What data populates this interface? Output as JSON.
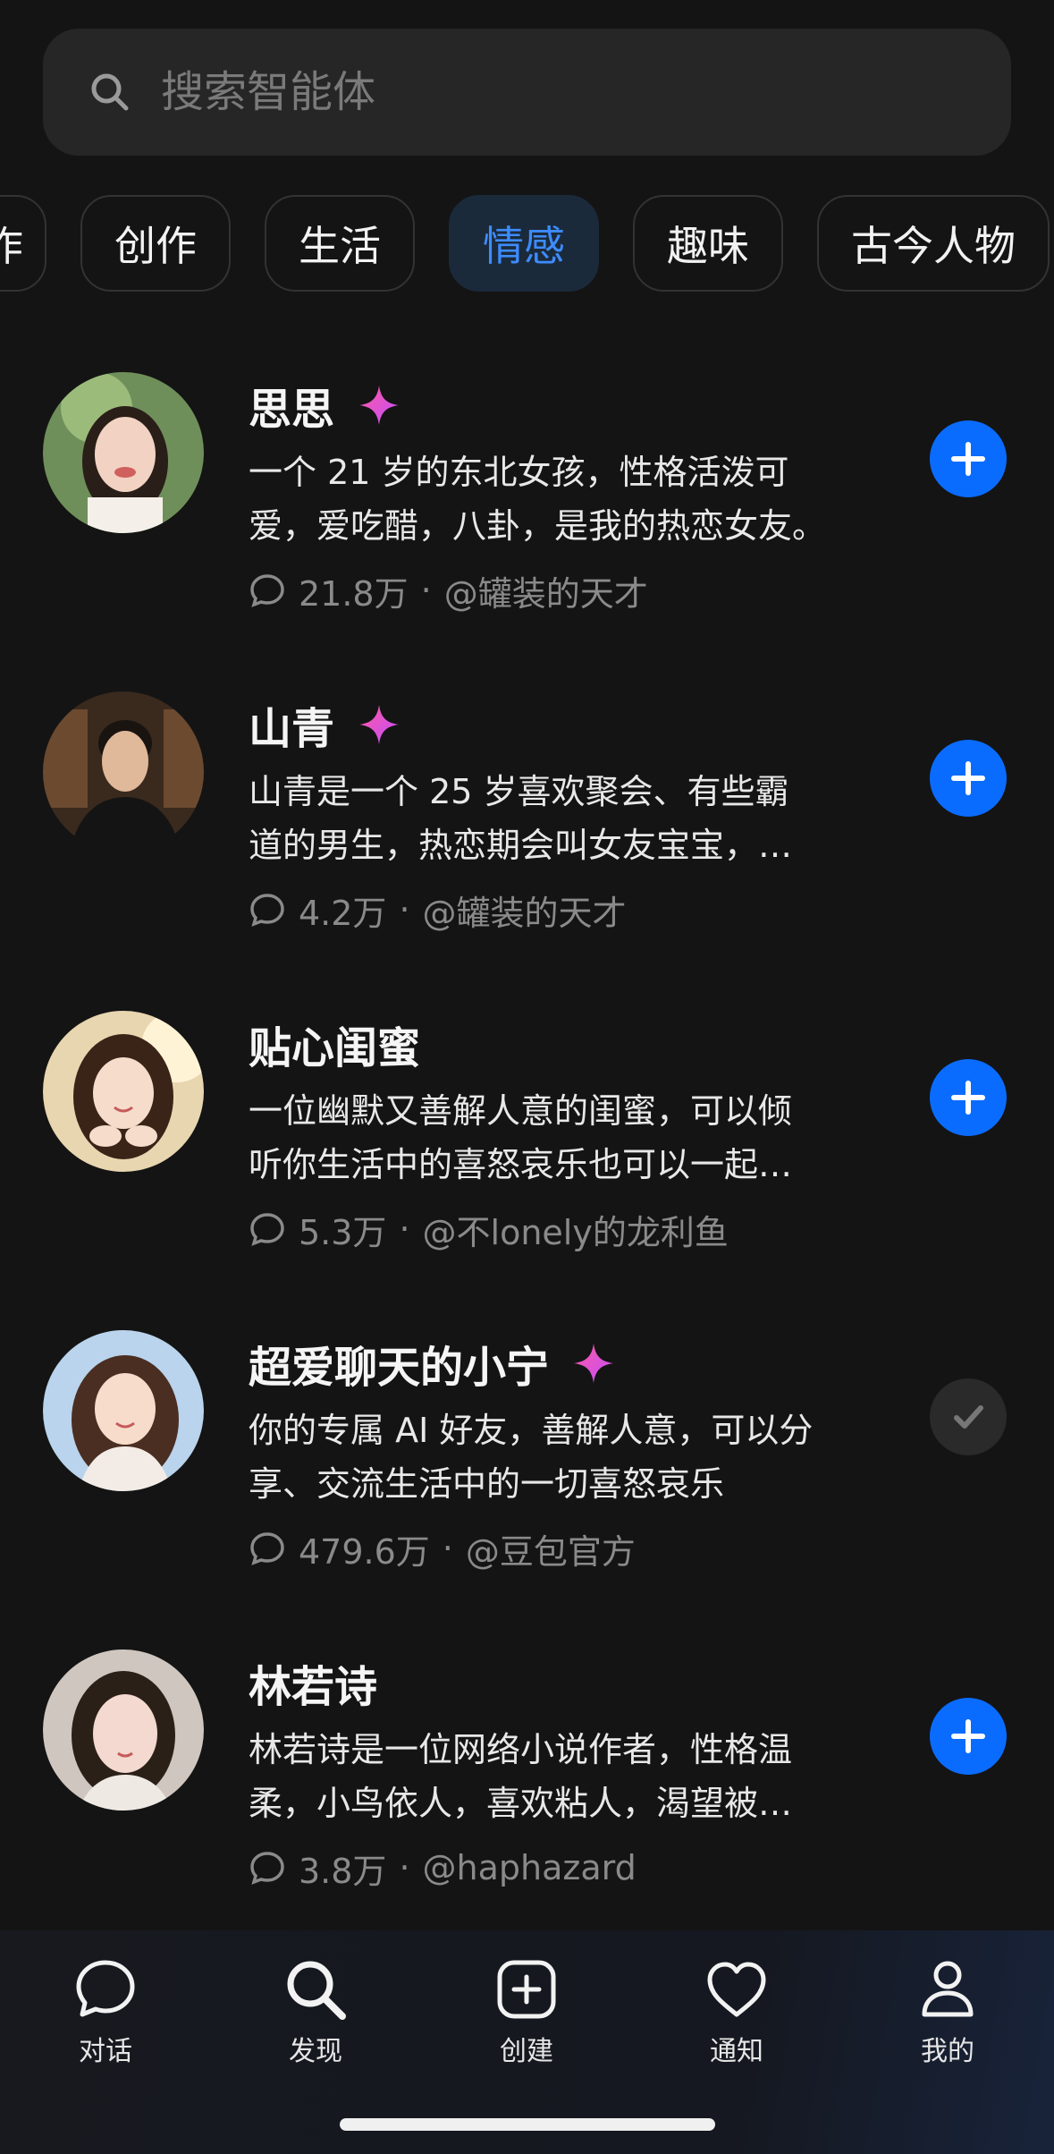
{
  "search": {
    "placeholder": "搜索智能体"
  },
  "tabs": [
    {
      "label": "作",
      "active": false
    },
    {
      "label": "创作",
      "active": false
    },
    {
      "label": "生活",
      "active": false
    },
    {
      "label": "情感",
      "active": true
    },
    {
      "label": "趣味",
      "active": false
    },
    {
      "label": "古今人物",
      "active": false
    }
  ],
  "agents": [
    {
      "name": "思思",
      "sparkle": true,
      "desc_line1": "一个 21 岁的东北女孩，性格活泼可",
      "desc_line2": "爱，爱吃醋，八卦，是我的热恋女友。",
      "count": "21.8万",
      "author": "@罐装的天才",
      "added": false
    },
    {
      "name": "山青",
      "sparkle": true,
      "desc_line1": "山青是一个 25 岁喜欢聚会、有些霸",
      "desc_line2": "道的男生，热恋期会叫女友宝宝，…",
      "count": "4.2万",
      "author": "@罐装的天才",
      "added": false
    },
    {
      "name": "贴心闺蜜",
      "sparkle": false,
      "desc_line1": "一位幽默又善解人意的闺蜜，可以倾",
      "desc_line2": "听你生活中的喜怒哀乐也可以一起…",
      "count": "5.3万",
      "author": "@不lonely的龙利鱼",
      "added": false
    },
    {
      "name": "超爱聊天的小宁",
      "sparkle": true,
      "desc_line1": "你的专属 AI 好友，善解人意，可以分",
      "desc_line2": "享、交流生活中的一切喜怒哀乐",
      "count": "479.6万",
      "author": "@豆包官方",
      "added": true
    },
    {
      "name": "林若诗",
      "sparkle": false,
      "desc_line1": "林若诗是一位网络小说作者，性格温",
      "desc_line2": "柔，小鸟依人，喜欢粘人，渴望被…",
      "count": "3.8万",
      "author": "@haphazard",
      "added": false
    }
  ],
  "nav": [
    {
      "label": "对话",
      "icon": "chat-icon"
    },
    {
      "label": "发现",
      "icon": "search-icon"
    },
    {
      "label": "创建",
      "icon": "create-icon"
    },
    {
      "label": "通知",
      "icon": "heart-icon"
    },
    {
      "label": "我的",
      "icon": "profile-icon"
    }
  ],
  "colors": {
    "accent": "#0a6cff",
    "active_tab_text": "#3d8cff",
    "background": "#141414"
  }
}
